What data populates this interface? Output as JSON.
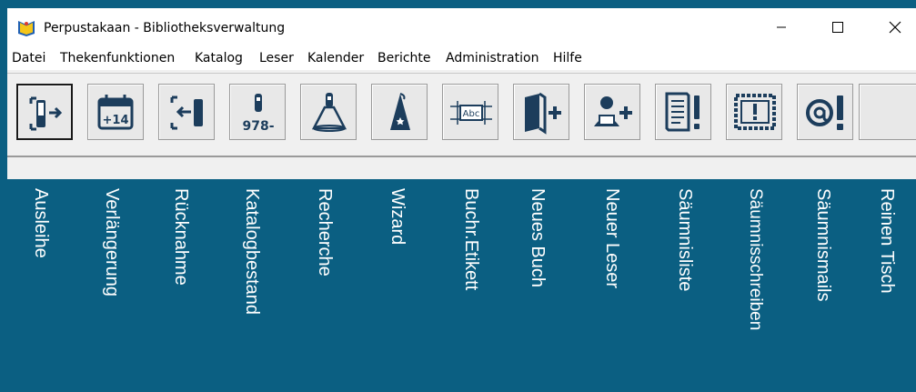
{
  "window": {
    "title": "Perpustakaan - Bibliotheksverwaltung",
    "controls": {
      "minimize": "—",
      "maximize": "☐",
      "close": "✕"
    }
  },
  "menu": [
    "Datei",
    "Thekenfunktionen",
    "Katalog",
    "Leser",
    "Kalender",
    "Berichte",
    "Administration",
    "Hilfe"
  ],
  "toolbar": {
    "buttons": [
      {
        "icon": "checkout-icon"
      },
      {
        "icon": "calendar-plus14-icon",
        "icon_text": "+14"
      },
      {
        "icon": "return-icon"
      },
      {
        "icon": "isbn-flashlight-icon",
        "icon_text": "978-"
      },
      {
        "icon": "flashlight-icon"
      },
      {
        "icon": "wizard-hat-icon"
      },
      {
        "icon": "label-icon",
        "icon_text": "Abc"
      },
      {
        "icon": "new-book-icon"
      },
      {
        "icon": "new-reader-icon"
      },
      {
        "icon": "overdue-list-icon"
      },
      {
        "icon": "overdue-letter-icon"
      },
      {
        "icon": "overdue-mail-icon"
      },
      {
        "icon": "blank-icon"
      }
    ]
  },
  "labels": [
    "Ausleihe",
    "Verlängerung",
    "Rücknahme",
    "Katalogbestand",
    "Recherche",
    "Wizard",
    "Buchr.Etikett",
    "Neues Buch",
    "Neuer Leser",
    "Säumnisliste",
    "Säumnisschreiben",
    "Säumnismails",
    "Reinen Tisch"
  ],
  "colors": {
    "background": "#0b5f82",
    "icon": "#1c3d5c",
    "label": "#ffffff"
  }
}
